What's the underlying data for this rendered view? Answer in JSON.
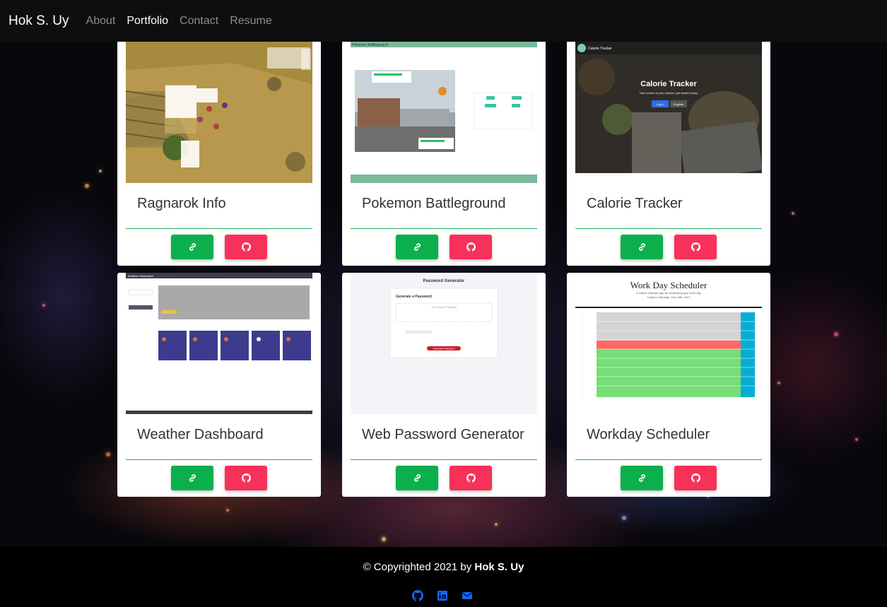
{
  "brand": "Hok S. Uy",
  "nav": {
    "about": "About",
    "portfolio": "Portfolio",
    "contact": "Contact",
    "resume": "Resume"
  },
  "projects": [
    {
      "title": "Ragnarok Info"
    },
    {
      "title": "Pokemon Battleground"
    },
    {
      "title": "Calorie Tracker"
    },
    {
      "title": "Weather Dashboard"
    },
    {
      "title": "Web Password Generator"
    },
    {
      "title": "Workday Scheduler"
    }
  ],
  "thumbs": {
    "pokemon_header": "Pokemon Battleground",
    "calorie_app": "Calorie Tracker",
    "calorie_heading": "Calorie Tracker",
    "calorie_sub": "Take control of your calories, get started today!",
    "calorie_login": "Log in",
    "calorie_register": "Register",
    "weather_header": "Weather Dashboard",
    "password_title": "Password Generator",
    "password_card": "Generate a Password",
    "password_placeholder": "Your Secure Password",
    "password_button": "Generate Password",
    "scheduler_title": "Work Day Scheduler",
    "scheduler_sub1": "A simple calendar app for scheduling your work day",
    "scheduler_sub2": "Today is Saturday, July 24th, 2021"
  },
  "footer": {
    "copy": "© Copyrighted 2021 by ",
    "owner": "Hok S. Uy"
  },
  "colors": {
    "accent_green": "#0bb04c",
    "accent_red": "#f73159",
    "social_blue": "#1565ff"
  },
  "icons": [
    "link-icon",
    "github-icon",
    "linkedin-icon",
    "envelope-icon"
  ]
}
